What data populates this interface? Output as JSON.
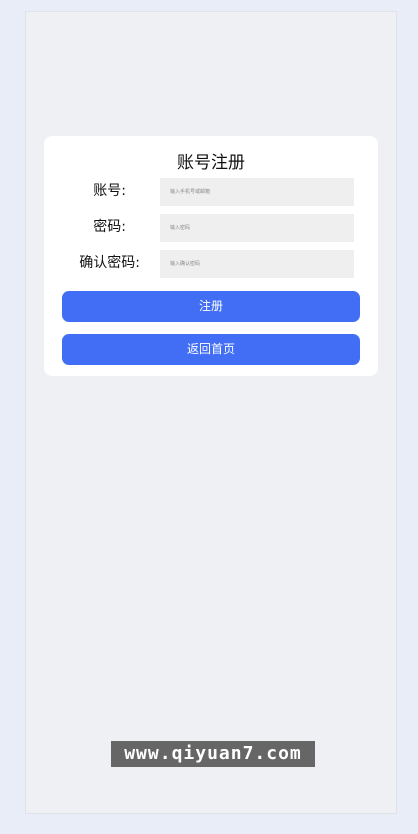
{
  "form": {
    "title": "账号注册",
    "fields": [
      {
        "label": "账号:",
        "placeholder": "输入手机号或邮箱"
      },
      {
        "label": "密码:",
        "placeholder": "输入密码"
      },
      {
        "label": "确认密码:",
        "placeholder": "输入确认密码"
      }
    ],
    "register_label": "注册",
    "home_label": "返回首页"
  },
  "watermark": "www.qiyuan7.com",
  "colors": {
    "page_bg": "#e8edf7",
    "screen_bg": "#eff0f4",
    "card_bg": "#ffffff",
    "button": "#416ef5",
    "input_bg": "#efefef"
  }
}
